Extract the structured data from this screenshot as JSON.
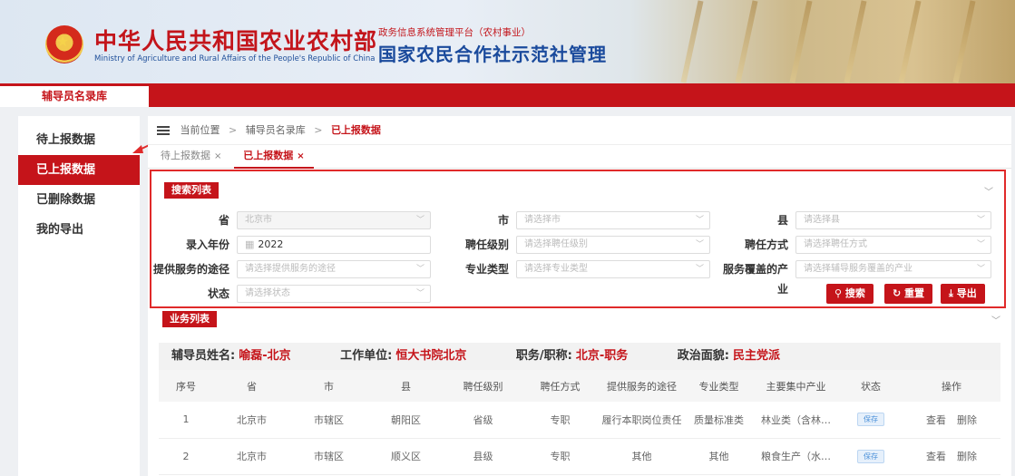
{
  "header": {
    "ministry_cn": "中华人民共和国农业农村部",
    "ministry_en": "Ministry of Agriculture and Rural Affairs of the People's Republic of China",
    "platform_sub": "政务信息系统管理平台（农村事业）",
    "platform_title": "国家农民合作社示范社管理",
    "emblem_icon": "national-emblem-icon"
  },
  "top_tab": "辅导员名录库",
  "sidebar": {
    "items": [
      {
        "label": "待上报数据",
        "active": false
      },
      {
        "label": "已上报数据",
        "active": true
      },
      {
        "label": "已删除数据",
        "active": false
      },
      {
        "label": "我的导出",
        "active": false
      }
    ]
  },
  "breadcrumb": {
    "prefix": "当前位置",
    "level1": "辅导员名录库",
    "current": "已上报数据",
    "separator": ">"
  },
  "tabs": [
    {
      "label": "待上报数据",
      "close": "×",
      "active": false
    },
    {
      "label": "已上报数据",
      "close": "×",
      "active": true
    }
  ],
  "search": {
    "section_label": "搜索列表",
    "fields": {
      "province": {
        "label": "省",
        "value": "北京市"
      },
      "city": {
        "label": "市",
        "placeholder": "请选择市"
      },
      "county": {
        "label": "县",
        "placeholder": "请选择县"
      },
      "year": {
        "label": "录入年份",
        "value": "2022"
      },
      "level": {
        "label": "聘任级别",
        "placeholder": "请选择聘任级别"
      },
      "method": {
        "label": "聘任方式",
        "placeholder": "请选择聘任方式"
      },
      "service_way": {
        "label": "提供服务的途径",
        "placeholder": "请选择提供服务的途径"
      },
      "major": {
        "label": "专业类型",
        "placeholder": "请选择专业类型"
      },
      "industry": {
        "label": "服务覆盖的产业",
        "placeholder": "请选择辅导服务覆盖的产业"
      },
      "status": {
        "label": "状态",
        "placeholder": "请选择状态"
      }
    },
    "buttons": {
      "search": "搜索",
      "reset": "重置",
      "export": "导出"
    }
  },
  "business": {
    "section_label": "业务列表",
    "info": {
      "name_label": "辅导员姓名:",
      "name": "喻磊-北京",
      "unit_label": "工作单位:",
      "unit": "恒大书院北京",
      "title_label": "职务/职称:",
      "title": "北京-职务",
      "party_label": "政治面貌:",
      "party": "民主党派"
    },
    "columns": [
      "序号",
      "省",
      "市",
      "县",
      "聘任级别",
      "聘任方式",
      "提供服务的途径",
      "专业类型",
      "主要集中产业",
      "状态",
      "操作"
    ],
    "rows": [
      {
        "no": "1",
        "province": "北京市",
        "city": "市辖区",
        "county": "朝阳区",
        "level": "省级",
        "method": "专职",
        "way": "履行本职岗位责任",
        "major": "质量标准类",
        "industry": "林业类（含林…",
        "status": "保存",
        "view": "查看",
        "delete": "删除"
      },
      {
        "no": "2",
        "province": "北京市",
        "city": "市辖区",
        "county": "顺义区",
        "level": "县级",
        "method": "专职",
        "way": "其他",
        "major": "其他",
        "industry": "粮食生产（水…",
        "status": "保存",
        "view": "查看",
        "delete": "删除"
      }
    ]
  },
  "colors": {
    "brand_red": "#c5141a",
    "annotation_red": "#e02a2a",
    "title_blue": "#1a4a9c"
  }
}
